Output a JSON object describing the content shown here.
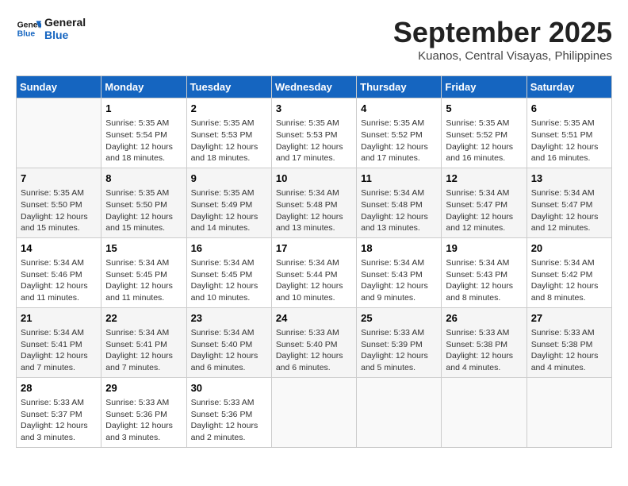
{
  "logo": {
    "line1": "General",
    "line2": "Blue"
  },
  "title": "September 2025",
  "location": "Kuanos, Central Visayas, Philippines",
  "days_of_week": [
    "Sunday",
    "Monday",
    "Tuesday",
    "Wednesday",
    "Thursday",
    "Friday",
    "Saturday"
  ],
  "weeks": [
    [
      {
        "day": "",
        "info": ""
      },
      {
        "day": "1",
        "info": "Sunrise: 5:35 AM\nSunset: 5:54 PM\nDaylight: 12 hours\nand 18 minutes."
      },
      {
        "day": "2",
        "info": "Sunrise: 5:35 AM\nSunset: 5:53 PM\nDaylight: 12 hours\nand 18 minutes."
      },
      {
        "day": "3",
        "info": "Sunrise: 5:35 AM\nSunset: 5:53 PM\nDaylight: 12 hours\nand 17 minutes."
      },
      {
        "day": "4",
        "info": "Sunrise: 5:35 AM\nSunset: 5:52 PM\nDaylight: 12 hours\nand 17 minutes."
      },
      {
        "day": "5",
        "info": "Sunrise: 5:35 AM\nSunset: 5:52 PM\nDaylight: 12 hours\nand 16 minutes."
      },
      {
        "day": "6",
        "info": "Sunrise: 5:35 AM\nSunset: 5:51 PM\nDaylight: 12 hours\nand 16 minutes."
      }
    ],
    [
      {
        "day": "7",
        "info": "Sunrise: 5:35 AM\nSunset: 5:50 PM\nDaylight: 12 hours\nand 15 minutes."
      },
      {
        "day": "8",
        "info": "Sunrise: 5:35 AM\nSunset: 5:50 PM\nDaylight: 12 hours\nand 15 minutes."
      },
      {
        "day": "9",
        "info": "Sunrise: 5:35 AM\nSunset: 5:49 PM\nDaylight: 12 hours\nand 14 minutes."
      },
      {
        "day": "10",
        "info": "Sunrise: 5:34 AM\nSunset: 5:48 PM\nDaylight: 12 hours\nand 13 minutes."
      },
      {
        "day": "11",
        "info": "Sunrise: 5:34 AM\nSunset: 5:48 PM\nDaylight: 12 hours\nand 13 minutes."
      },
      {
        "day": "12",
        "info": "Sunrise: 5:34 AM\nSunset: 5:47 PM\nDaylight: 12 hours\nand 12 minutes."
      },
      {
        "day": "13",
        "info": "Sunrise: 5:34 AM\nSunset: 5:47 PM\nDaylight: 12 hours\nand 12 minutes."
      }
    ],
    [
      {
        "day": "14",
        "info": "Sunrise: 5:34 AM\nSunset: 5:46 PM\nDaylight: 12 hours\nand 11 minutes."
      },
      {
        "day": "15",
        "info": "Sunrise: 5:34 AM\nSunset: 5:45 PM\nDaylight: 12 hours\nand 11 minutes."
      },
      {
        "day": "16",
        "info": "Sunrise: 5:34 AM\nSunset: 5:45 PM\nDaylight: 12 hours\nand 10 minutes."
      },
      {
        "day": "17",
        "info": "Sunrise: 5:34 AM\nSunset: 5:44 PM\nDaylight: 12 hours\nand 10 minutes."
      },
      {
        "day": "18",
        "info": "Sunrise: 5:34 AM\nSunset: 5:43 PM\nDaylight: 12 hours\nand 9 minutes."
      },
      {
        "day": "19",
        "info": "Sunrise: 5:34 AM\nSunset: 5:43 PM\nDaylight: 12 hours\nand 8 minutes."
      },
      {
        "day": "20",
        "info": "Sunrise: 5:34 AM\nSunset: 5:42 PM\nDaylight: 12 hours\nand 8 minutes."
      }
    ],
    [
      {
        "day": "21",
        "info": "Sunrise: 5:34 AM\nSunset: 5:41 PM\nDaylight: 12 hours\nand 7 minutes."
      },
      {
        "day": "22",
        "info": "Sunrise: 5:34 AM\nSunset: 5:41 PM\nDaylight: 12 hours\nand 7 minutes."
      },
      {
        "day": "23",
        "info": "Sunrise: 5:34 AM\nSunset: 5:40 PM\nDaylight: 12 hours\nand 6 minutes."
      },
      {
        "day": "24",
        "info": "Sunrise: 5:33 AM\nSunset: 5:40 PM\nDaylight: 12 hours\nand 6 minutes."
      },
      {
        "day": "25",
        "info": "Sunrise: 5:33 AM\nSunset: 5:39 PM\nDaylight: 12 hours\nand 5 minutes."
      },
      {
        "day": "26",
        "info": "Sunrise: 5:33 AM\nSunset: 5:38 PM\nDaylight: 12 hours\nand 4 minutes."
      },
      {
        "day": "27",
        "info": "Sunrise: 5:33 AM\nSunset: 5:38 PM\nDaylight: 12 hours\nand 4 minutes."
      }
    ],
    [
      {
        "day": "28",
        "info": "Sunrise: 5:33 AM\nSunset: 5:37 PM\nDaylight: 12 hours\nand 3 minutes."
      },
      {
        "day": "29",
        "info": "Sunrise: 5:33 AM\nSunset: 5:36 PM\nDaylight: 12 hours\nand 3 minutes."
      },
      {
        "day": "30",
        "info": "Sunrise: 5:33 AM\nSunset: 5:36 PM\nDaylight: 12 hours\nand 2 minutes."
      },
      {
        "day": "",
        "info": ""
      },
      {
        "day": "",
        "info": ""
      },
      {
        "day": "",
        "info": ""
      },
      {
        "day": "",
        "info": ""
      }
    ]
  ]
}
